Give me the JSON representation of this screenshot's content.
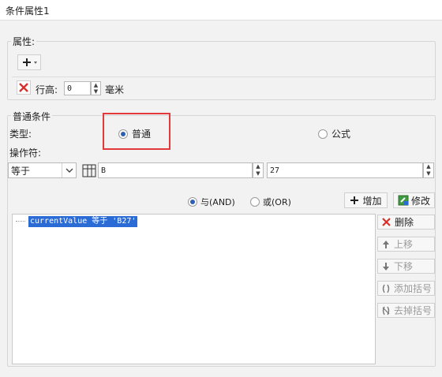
{
  "window": {
    "title": "条件属性1"
  },
  "properties": {
    "group_label": "属性:",
    "row_height_label": "行高:",
    "row_height_value": "0",
    "row_height_unit": "毫米"
  },
  "condition": {
    "group_label": "普通条件",
    "type_label": "类型:",
    "type_options": [
      {
        "label": "普通",
        "selected": true
      },
      {
        "label": "公式",
        "selected": false
      }
    ],
    "operator_label": "操作符:",
    "operator_value": "等于",
    "field_value_1": "B",
    "field_value_2": "27",
    "logic_options": [
      {
        "label": "与(AND)",
        "selected": true
      },
      {
        "label": "或(OR)",
        "selected": false
      }
    ],
    "add_button": "增加",
    "modify_button": "修改",
    "list_items": [
      "currentValue 等于 'B27'"
    ]
  },
  "side_buttons": {
    "delete": "删除",
    "move_up": "上移",
    "move_down": "下移",
    "add_bracket": "添加括号",
    "remove_bracket": "去掉括号"
  },
  "colors": {
    "highlight": "#e23a3a",
    "selection": "#2b6bd6"
  }
}
